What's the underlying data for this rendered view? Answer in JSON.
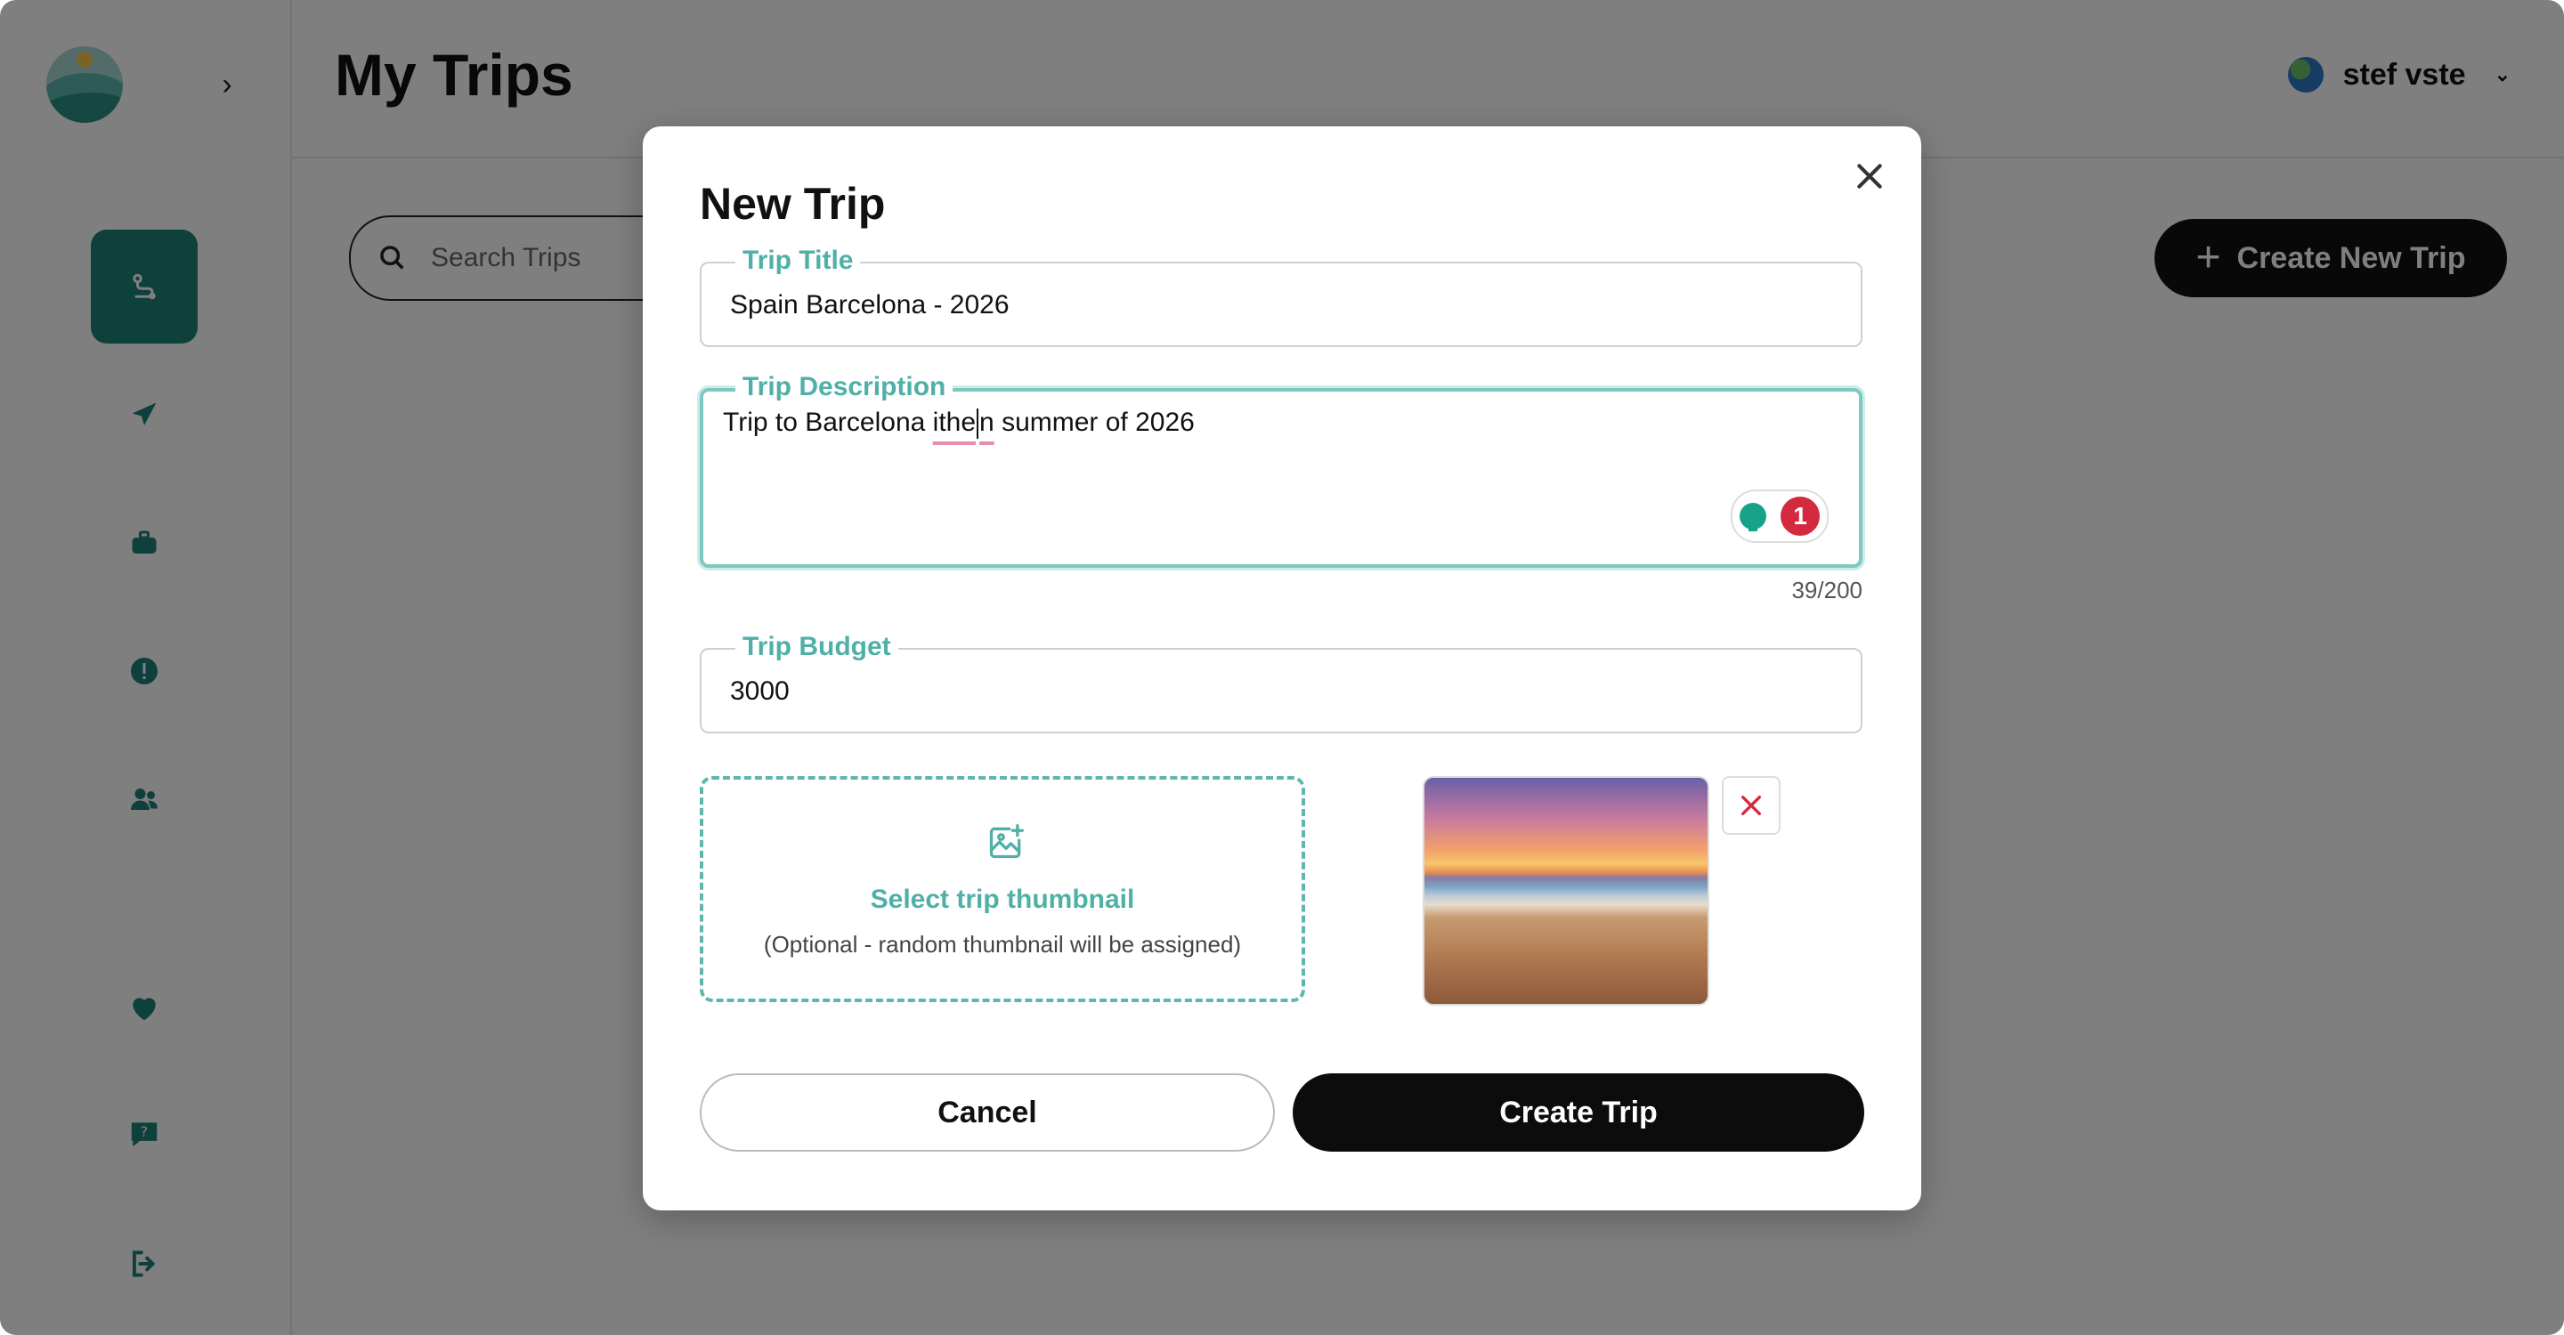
{
  "header": {
    "title": "My Trips",
    "user_name": "stef vste"
  },
  "search": {
    "placeholder": "Search Trips"
  },
  "create_new_label": "Create New Trip",
  "sidebar": {
    "items": [
      {
        "icon": "route-icon",
        "active": true
      },
      {
        "icon": "paper-plane-icon",
        "active": false
      },
      {
        "icon": "suitcase-icon",
        "active": false
      },
      {
        "icon": "alert-icon",
        "active": false
      },
      {
        "icon": "users-icon",
        "active": false
      }
    ],
    "bottom": [
      {
        "icon": "heart-icon"
      },
      {
        "icon": "help-chat-icon"
      },
      {
        "icon": "logout-icon"
      }
    ]
  },
  "modal": {
    "title": "New Trip",
    "title_field": {
      "label": "Trip Title",
      "value": "Spain Barcelona - 2026"
    },
    "description_field": {
      "label": "Trip Description",
      "value_part1": "Trip to Barcelona ",
      "value_misspelled_a": "ithe",
      "value_misspelled_b": "n",
      "value_part2": " summer of 2026",
      "char_count": "39/200",
      "grammar_issue_count": "1"
    },
    "budget_field": {
      "label": "Trip Budget",
      "value": "3000"
    },
    "thumbnail": {
      "select_label": "Select trip thumbnail",
      "hint": "(Optional - random thumbnail will be assigned)"
    },
    "cancel_label": "Cancel",
    "create_label": "Create Trip"
  },
  "colors": {
    "accent": "#1d8079",
    "accent_light": "#4fb0a7",
    "danger": "#d42a3f"
  }
}
